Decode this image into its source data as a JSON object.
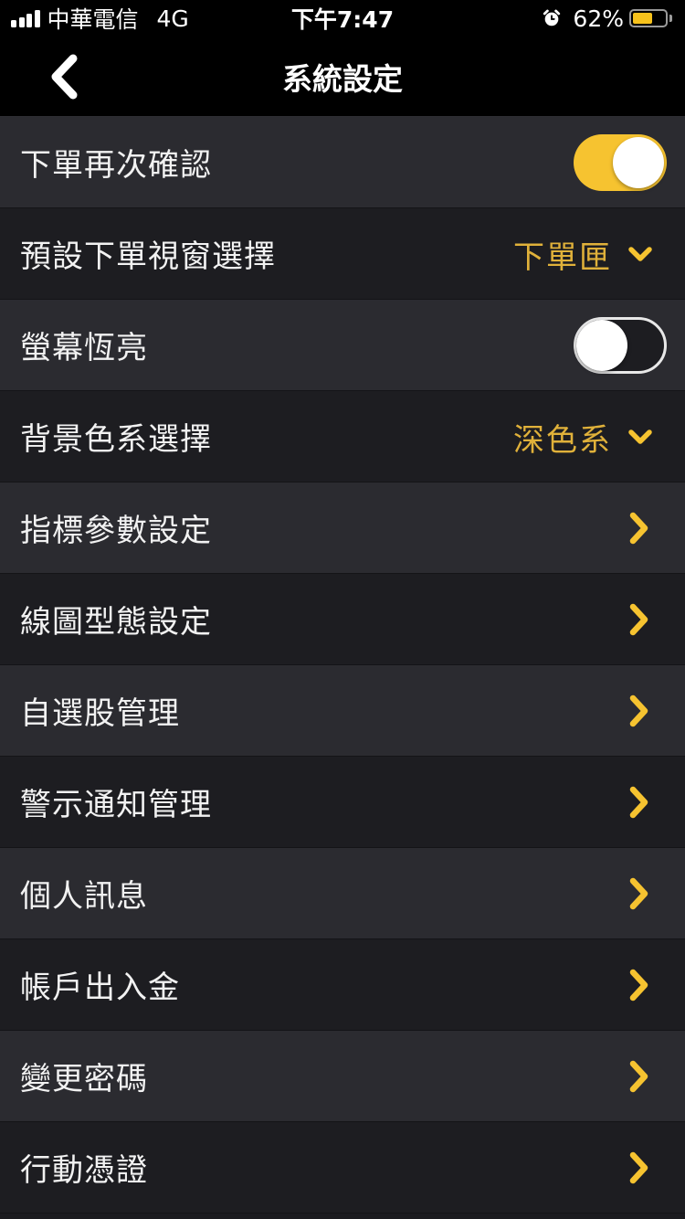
{
  "status_bar": {
    "carrier": "中華電信",
    "network": "4G",
    "time": "下午7:47",
    "battery_percent": "62%",
    "battery_level": 0.62
  },
  "nav": {
    "title": "系統設定",
    "back_icon": "chevron-left-icon"
  },
  "colors": {
    "accent": "#f6c330",
    "select_text": "#e0b13a",
    "row_dark": "#1d1d21",
    "row_light": "#2b2b30"
  },
  "settings": [
    {
      "label": "下單再次確認",
      "type": "toggle",
      "on": true
    },
    {
      "label": "預設下單視窗選擇",
      "type": "select",
      "value": "下單匣"
    },
    {
      "label": "螢幕恆亮",
      "type": "toggle",
      "on": false
    },
    {
      "label": "背景色系選擇",
      "type": "select",
      "value": "深色系"
    },
    {
      "label": "指標參數設定",
      "type": "link"
    },
    {
      "label": "線圖型態設定",
      "type": "link"
    },
    {
      "label": "自選股管理",
      "type": "link"
    },
    {
      "label": "警示通知管理",
      "type": "link"
    },
    {
      "label": "個人訊息",
      "type": "link"
    },
    {
      "label": "帳戶出入金",
      "type": "link"
    },
    {
      "label": "變更密碼",
      "type": "link"
    },
    {
      "label": "行動憑證",
      "type": "link"
    }
  ]
}
